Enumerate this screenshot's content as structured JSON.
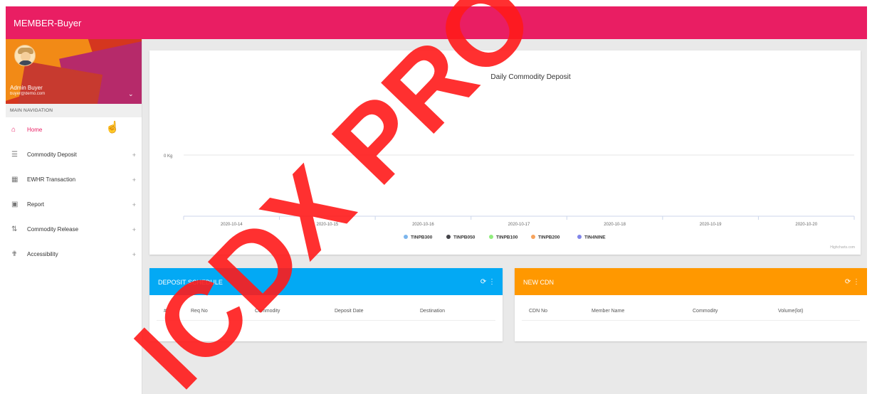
{
  "app": {
    "title": "MEMBER-Buyer"
  },
  "user": {
    "name": "Admin Buyer",
    "email": "buyer@demo.com"
  },
  "nav": {
    "header": "MAIN NAVIGATION",
    "items": [
      {
        "label": "Home",
        "icon": "home-icon",
        "active": true
      },
      {
        "label": "Commodity Deposit",
        "icon": "list-icon",
        "expand": "+"
      },
      {
        "label": "EWHR Transaction",
        "icon": "grid-icon",
        "expand": "+"
      },
      {
        "label": "Report",
        "icon": "report-icon",
        "expand": "+"
      },
      {
        "label": "Commodity Release",
        "icon": "sort-icon",
        "expand": "+"
      },
      {
        "label": "Accessibility",
        "icon": "accessibility-icon",
        "expand": "+"
      }
    ]
  },
  "chart_data": {
    "type": "line",
    "title": "Daily Commodity Deposit",
    "x": [
      "2020-10-14",
      "2020-10-15",
      "2020-10-16",
      "2020-10-17",
      "2020-10-18",
      "2020-10-19",
      "2020-10-20"
    ],
    "y_ticks": [
      "0 Kg"
    ],
    "series": [
      {
        "name": "TINPB300",
        "color": "#7cb5ec",
        "values": [
          0,
          0,
          0,
          0,
          0,
          0,
          0
        ]
      },
      {
        "name": "TINPB050",
        "color": "#434348",
        "values": [
          0,
          0,
          0,
          0,
          0,
          0,
          0
        ]
      },
      {
        "name": "TINPB100",
        "color": "#90ed7d",
        "values": [
          0,
          0,
          0,
          0,
          0,
          0,
          0
        ]
      },
      {
        "name": "TINPB200",
        "color": "#f7a35c",
        "values": [
          0,
          0,
          0,
          0,
          0,
          0,
          0
        ]
      },
      {
        "name": "TIN4NINE",
        "color": "#8085e9",
        "values": [
          0,
          0,
          0,
          0,
          0,
          0,
          0
        ]
      }
    ],
    "legend": "bottom",
    "credits": "Highcharts.com"
  },
  "deposit_schedule": {
    "title": "DEPOSIT SCHEDULE",
    "columns": [
      "#",
      "Req No",
      "Commodity",
      "Deposit Date",
      "Destination"
    ]
  },
  "new_cdn": {
    "title": "NEW CDN",
    "columns": [
      "CDN No",
      "Member Name",
      "Commodity",
      "Volume(lot)"
    ]
  },
  "watermark": {
    "text": "ICDX PRO"
  },
  "colors": {
    "primary": "#e91e63",
    "blue": "#03a9f4",
    "orange": "#ff9800"
  }
}
